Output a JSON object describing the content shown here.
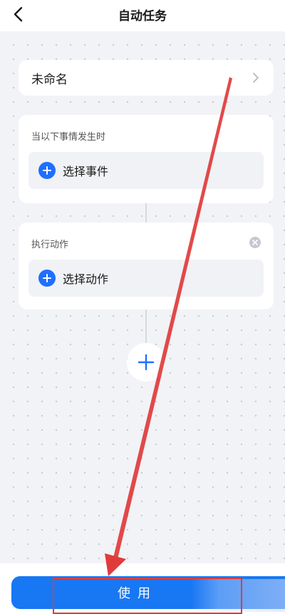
{
  "header": {
    "title": "自动任务",
    "back_icon": "chevron-left-icon"
  },
  "name_card": {
    "label": "未命名",
    "chevron_icon": "chevron-right-icon"
  },
  "trigger_section": {
    "title": "当以下事情发生时",
    "pick_label": "选择事件",
    "plus_icon": "plus-circle-icon"
  },
  "action_section": {
    "title": "执行动作",
    "pick_label": "选择动作",
    "plus_icon": "plus-circle-icon",
    "close_icon": "close-icon"
  },
  "add_button_icon": "plus-icon",
  "footer": {
    "use_label": "使用"
  },
  "colors": {
    "accent": "#1877f2",
    "plus_blue": "#1f6fff",
    "canvas_bg": "#f2f3f6",
    "annotation_red": "#e03b3b"
  }
}
